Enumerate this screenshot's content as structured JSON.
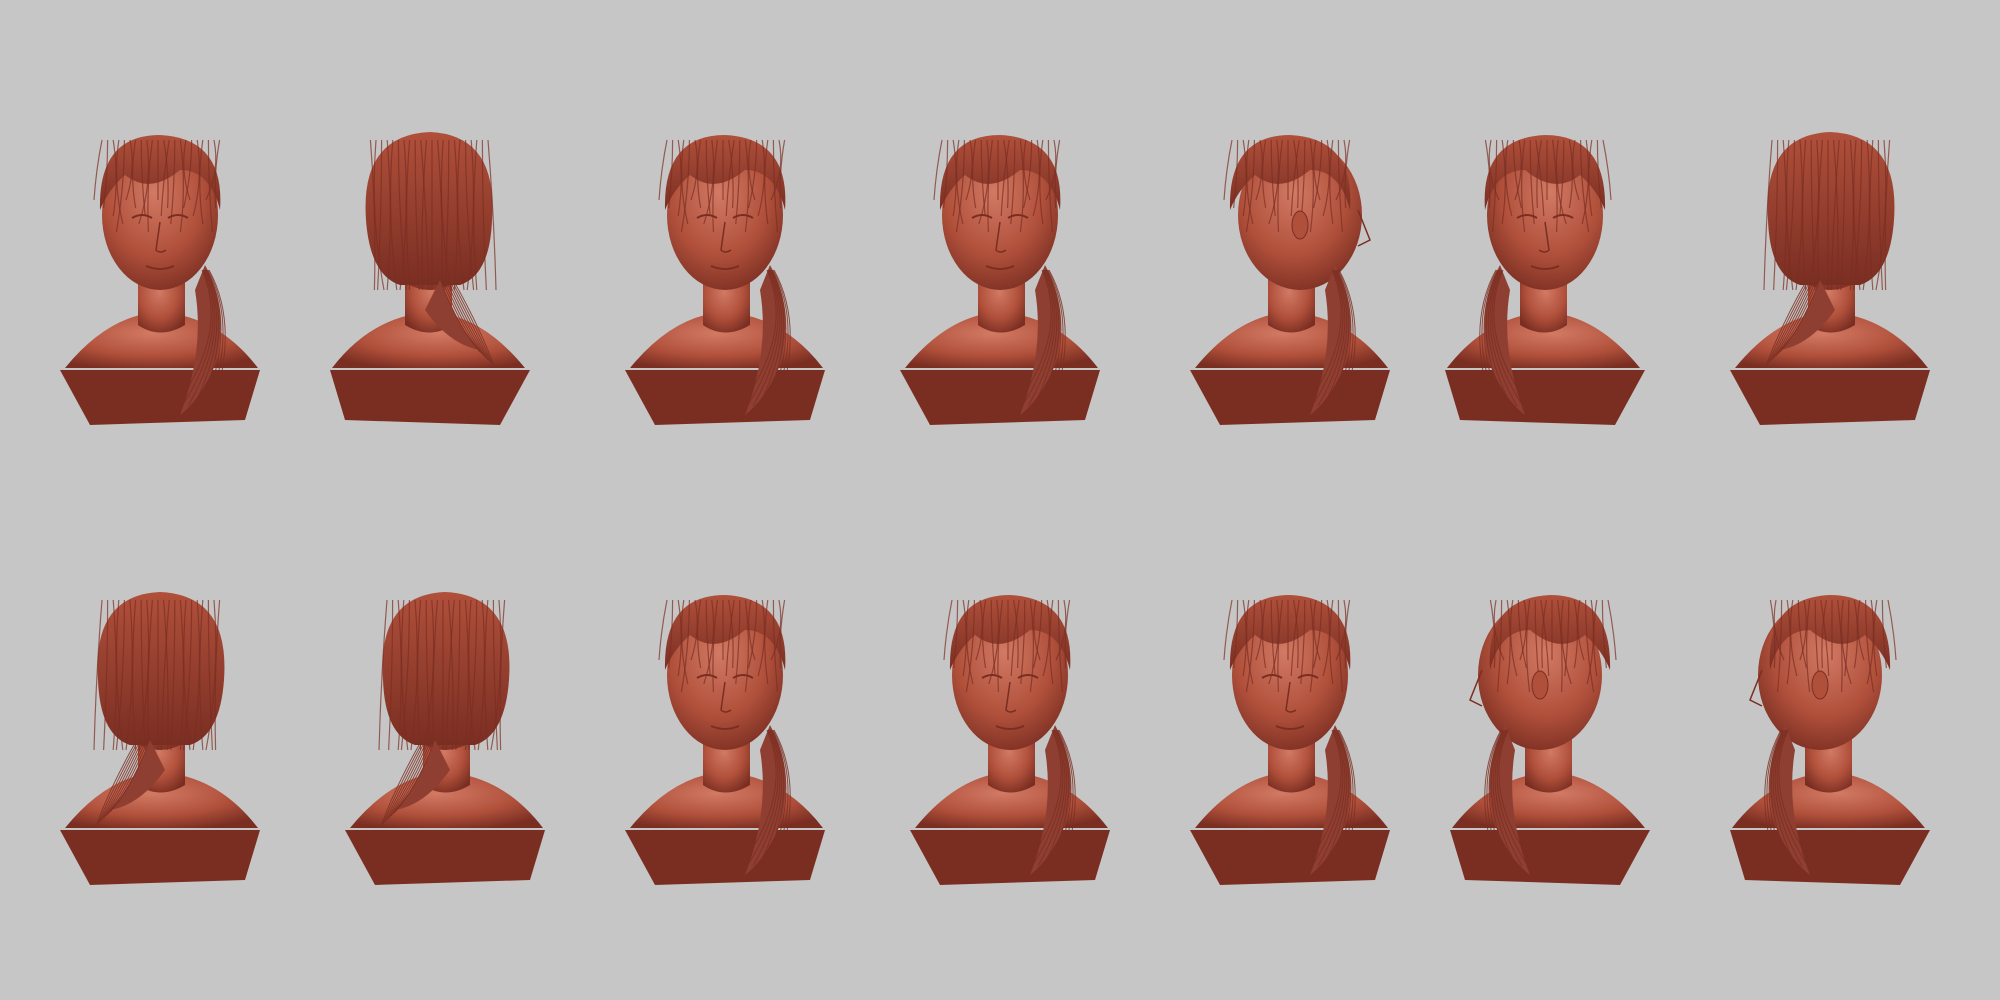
{
  "scene": {
    "background_color": "#c6c6c6",
    "material_color": "#b0503b",
    "material_dark": "#7a2e22",
    "material_light": "#d27a64",
    "hair_color": "#8f3f31"
  },
  "turnaround": {
    "rows": 2,
    "columns": 7,
    "row1_views": [
      "front-low-three-quarter",
      "back-three-quarter-left",
      "front-three-quarter-right",
      "front",
      "right-profile",
      "left-three-quarter",
      "back-right"
    ],
    "row2_views": [
      "back-three-quarter-right",
      "back",
      "front-looking-down",
      "front-three-quarter-down",
      "right-three-quarter",
      "left-profile-back",
      "left-three-quarter-side"
    ]
  }
}
